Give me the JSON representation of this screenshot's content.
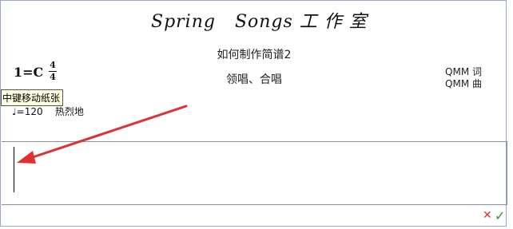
{
  "header": {
    "brand": "Spring   Songs 工 作 室"
  },
  "score": {
    "title": "如何制作简谱2",
    "subtitle": "领唱、合唱",
    "key": "1=C",
    "time_top": "4",
    "time_bottom": "4",
    "lyricist": "QMM 词",
    "composer": "QMM 曲",
    "tempo": "♩=120    热烈地"
  },
  "tooltip": {
    "text": "中键移动纸张"
  },
  "annotation": {
    "arrow_color": "#e03030"
  },
  "actions": {
    "cancel_icon": "✕",
    "confirm_icon": "✓"
  }
}
